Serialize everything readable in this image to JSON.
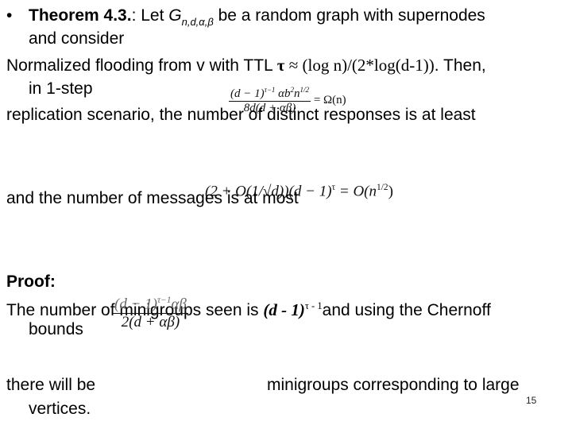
{
  "slide": {
    "bullet": "•",
    "theorem": {
      "label": "Theorem 4.3.",
      "after_label": ": Let ",
      "graph_symbol": "G",
      "graph_subscript": "n,d,α,β",
      "rest": " be a random graph with supernodes",
      "line2": "and consider"
    },
    "flooding": {
      "prefix": "Normalized flooding from v with TTL ",
      "tau": "τ",
      "formula": " ≈ (log n)/(2*log(d-1))",
      "suffix": ". Then,",
      "line2": "in 1-step"
    },
    "replication_line": "replication scenario, the number of distinct responses is at least",
    "formula1": {
      "numerator": "(d − 1)",
      "num_sup": "τ−1",
      "num_rest": "αb",
      "num_rest_sup": "2",
      "num_n": "n",
      "num_n_sup": "1/2",
      "denominator": "8d(d + αβ)",
      "rhs": "= Ω(n)"
    },
    "messages_line": "and the number of messages is at most",
    "formula2": {
      "left": "(2 + O(1/√d))(d − 1)",
      "left_sup": "τ",
      "rhs": "= O(n",
      "rhs_sup": "1/2",
      "rhs_close": ")"
    },
    "proof_label": "Proof:",
    "proof_line1_prefix": "The number of minigroups seen is ",
    "proof_expr": "(d - 1)",
    "proof_expr_sup": "τ - 1",
    "proof_line1_suffix": "and using the Chernoff",
    "proof_line2": "bounds",
    "formula3": {
      "numerator": "(d − 1)",
      "num_sup": "τ−1",
      "num_rest": "αβ",
      "denominator": "2(d + αβ)"
    },
    "last_line1_left": "there will be",
    "last_line1_right": "minigroups corresponding to large",
    "last_line2": "vertices.",
    "page_number": "15"
  }
}
